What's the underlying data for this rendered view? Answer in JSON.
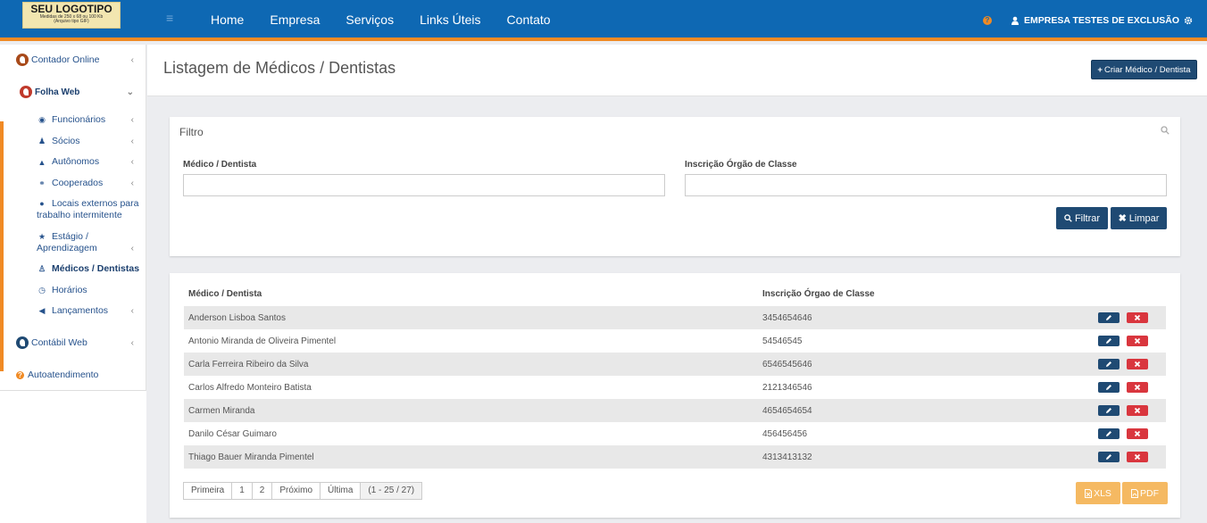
{
  "logo": {
    "title": "SEU LOGOTIPO",
    "line1": "Medidas de 250 x 68 ou 100 Kb",
    "line2": "(Arquivo tipo GIF)"
  },
  "topnav": [
    "Home",
    "Empresa",
    "Serviços",
    "Links Úteis",
    "Contato"
  ],
  "user": {
    "name": "EMPRESA TESTES DE EXCLUSÃO"
  },
  "sidebar": {
    "contador": "Contador Online",
    "folha": "Folha Web",
    "items": [
      "Funcionários",
      "Sócios",
      "Autônomos",
      "Cooperados",
      "Locais externos para",
      "trabalho intermitente",
      "Estágio /",
      "Aprendizagem",
      "Médicos / Dentistas",
      "Horários",
      "Lançamentos"
    ],
    "contabil": "Contábil Web",
    "auto": "Autoatendimento"
  },
  "page": {
    "title": "Listagem de Médicos / Dentistas",
    "create_button": "Criar Médico / Dentista"
  },
  "filter": {
    "title": "Filtro",
    "label_name": "Médico / Dentista",
    "label_reg": "Inscrição Órgão de Classe",
    "value_name": "",
    "value_reg": "",
    "filter_button": "Filtrar",
    "clear_button": "Limpar"
  },
  "table": {
    "headers": [
      "Médico / Dentista",
      "Inscrição Órgao de Classe"
    ],
    "rows": [
      [
        "Anderson Lisboa Santos",
        "3454654646"
      ],
      [
        "Antonio Miranda de Oliveira Pimentel",
        "54546545"
      ],
      [
        "Carla Ferreira Ribeiro da Silva",
        "6546545646"
      ],
      [
        "Carlos Alfredo Monteiro Batista",
        "2121346546"
      ],
      [
        "Carmen Miranda",
        "4654654654"
      ],
      [
        "Danilo César Guimaro",
        "456456456"
      ],
      [
        "Thiago Bauer Miranda Pimentel",
        "4313413132"
      ]
    ]
  },
  "pager": {
    "first": "Primeira",
    "p1": "1",
    "p2": "2",
    "next": "Próximo",
    "last": "Última",
    "info": "(1 - 25 / 27)"
  },
  "export": {
    "xls": "XLS",
    "pdf": "PDF"
  },
  "colors": {
    "brand": "#0e68b3",
    "accent": "#f08a24",
    "button": "#1f4a73",
    "danger": "#d9363e",
    "export": "#f5b962"
  }
}
